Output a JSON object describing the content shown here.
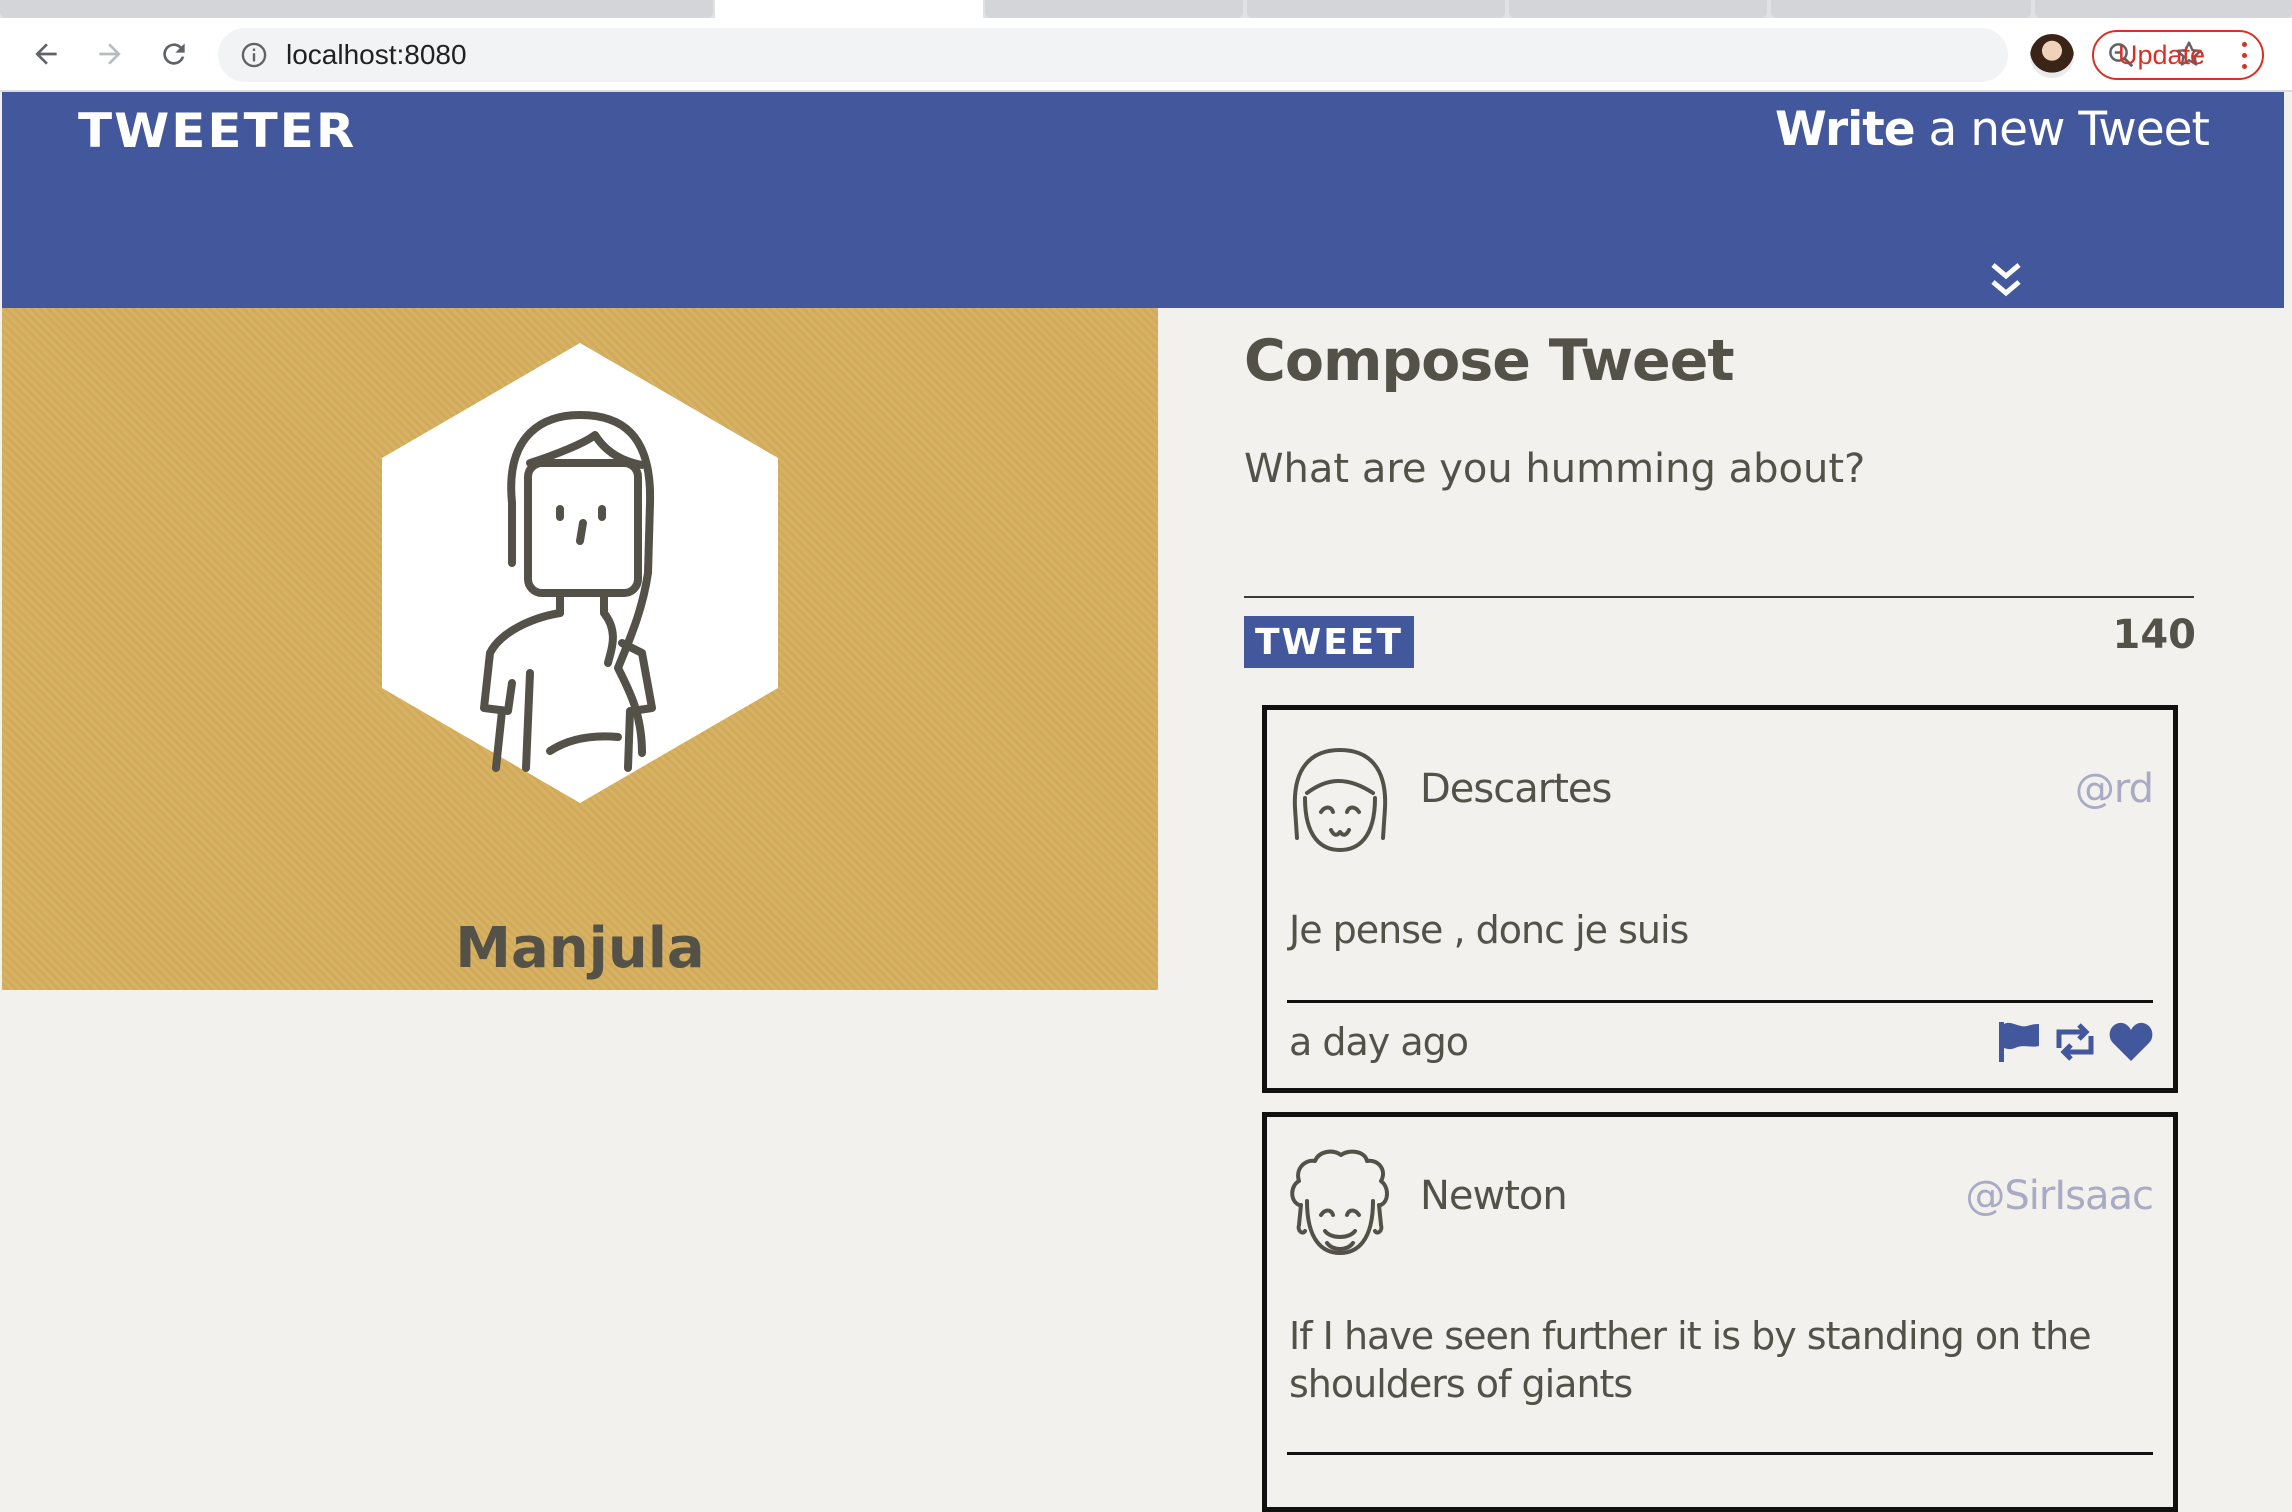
{
  "browser": {
    "url": "localhost:8080",
    "update_label": "Update"
  },
  "header": {
    "brand": "TWEETER",
    "write_bold": "Write",
    "write_rest": " a new Tweet"
  },
  "profile": {
    "name": "Manjula"
  },
  "compose": {
    "title": "Compose Tweet",
    "placeholder": "What are you humming about?",
    "button_label": "TWEET",
    "char_count": "140"
  },
  "tweets": [
    {
      "name": "Descartes",
      "handle": "@rd",
      "content": "Je pense , donc je suis",
      "time": "a day ago"
    },
    {
      "name": "Newton",
      "handle": "@SirIsaac",
      "content": "If I have seen further it is by standing on the shoulders of giants"
    }
  ],
  "colors": {
    "header_bg": "#43589c",
    "profile_bg": "#d5ae5c",
    "page_bg": "#f2f1ed",
    "text": "#545149",
    "handle": "#a9aac4",
    "update_red": "#d93025"
  },
  "icons": [
    "back-arrow-icon",
    "forward-arrow-icon",
    "reload-icon",
    "info-icon",
    "zoom-icon",
    "star-icon",
    "chevron-down-double-icon",
    "flag-icon",
    "retweet-icon",
    "heart-icon"
  ]
}
